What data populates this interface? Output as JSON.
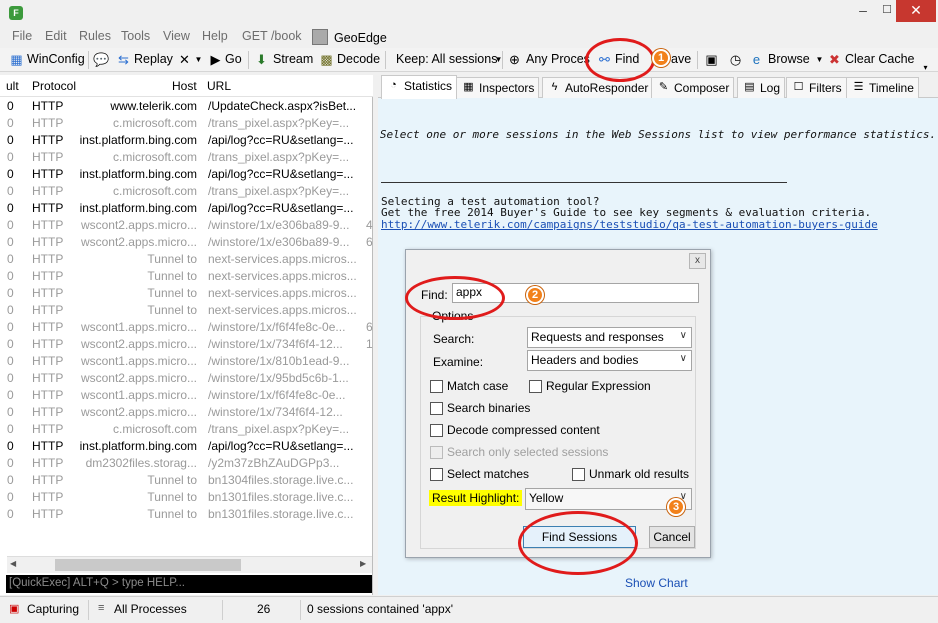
{
  "window": {
    "minimize": "–",
    "maximize": "☐",
    "close": "✕"
  },
  "menu": [
    "File",
    "Edit",
    "Rules",
    "Tools",
    "View",
    "Help",
    "GET /book"
  ],
  "geoedge": "GeoEdge",
  "toolbar": {
    "winconfig": "WinConfig",
    "replay": "Replay",
    "go": "Go",
    "stream": "Stream",
    "decode": "Decode",
    "keep": "Keep: All sessions",
    "any_process": "Any Proces",
    "find": "Find",
    "save": "ave",
    "browse": "Browse",
    "clear_cache": "Clear Cache"
  },
  "sessions": {
    "columns": [
      "ult",
      "Protocol",
      "Host",
      "URL"
    ],
    "rows": [
      {
        "r": "0",
        "protocol": "HTTP",
        "host": "www.telerik.com",
        "url": "/UpdateCheck.aspx?isBet...",
        "extra": "",
        "dim": false
      },
      {
        "r": "0",
        "protocol": "HTTP",
        "host": "c.microsoft.com",
        "url": "/trans_pixel.aspx?pKey=...",
        "extra": "",
        "dim": true
      },
      {
        "r": "0",
        "protocol": "HTTP",
        "host": "inst.platform.bing.com",
        "url": "/api/log?cc=RU&setlang=...",
        "extra": "",
        "dim": false
      },
      {
        "r": "0",
        "protocol": "HTTP",
        "host": "c.microsoft.com",
        "url": "/trans_pixel.aspx?pKey=...",
        "extra": "",
        "dim": true
      },
      {
        "r": "0",
        "protocol": "HTTP",
        "host": "inst.platform.bing.com",
        "url": "/api/log?cc=RU&setlang=...",
        "extra": "",
        "dim": false
      },
      {
        "r": "0",
        "protocol": "HTTP",
        "host": "c.microsoft.com",
        "url": "/trans_pixel.aspx?pKey=...",
        "extra": "",
        "dim": true
      },
      {
        "r": "0",
        "protocol": "HTTP",
        "host": "inst.platform.bing.com",
        "url": "/api/log?cc=RU&setlang=...",
        "extra": "",
        "dim": false
      },
      {
        "r": "0",
        "protocol": "HTTP",
        "host": "wscont2.apps.micro...",
        "url": "/winstore/1x/e306ba89-9...",
        "extra": "4",
        "dim": true
      },
      {
        "r": "0",
        "protocol": "HTTP",
        "host": "wscont2.apps.micro...",
        "url": "/winstore/1x/e306ba89-9...",
        "extra": "6",
        "dim": true
      },
      {
        "r": "0",
        "protocol": "HTTP",
        "host": "Tunnel to",
        "url": "next-services.apps.micros...",
        "extra": "",
        "dim": true
      },
      {
        "r": "0",
        "protocol": "HTTP",
        "host": "Tunnel to",
        "url": "next-services.apps.micros...",
        "extra": "",
        "dim": true
      },
      {
        "r": "0",
        "protocol": "HTTP",
        "host": "Tunnel to",
        "url": "next-services.apps.micros...",
        "extra": "",
        "dim": true
      },
      {
        "r": "0",
        "protocol": "HTTP",
        "host": "Tunnel to",
        "url": "next-services.apps.micros...",
        "extra": "",
        "dim": true
      },
      {
        "r": "0",
        "protocol": "HTTP",
        "host": "wscont1.apps.micro...",
        "url": "/winstore/1x/f6f4fe8c-0e...",
        "extra": "6",
        "dim": true
      },
      {
        "r": "0",
        "protocol": "HTTP",
        "host": "wscont2.apps.micro...",
        "url": "/winstore/1x/734f6f4-12...",
        "extra": "1",
        "dim": true
      },
      {
        "r": "0",
        "protocol": "HTTP",
        "host": "wscont1.apps.micro...",
        "url": "/winstore/1x/810b1ead-9...",
        "extra": "",
        "dim": true
      },
      {
        "r": "0",
        "protocol": "HTTP",
        "host": "wscont2.apps.micro...",
        "url": "/winstore/1x/95bd5c6b-1...",
        "extra": "",
        "dim": true
      },
      {
        "r": "0",
        "protocol": "HTTP",
        "host": "wscont1.apps.micro...",
        "url": "/winstore/1x/f6f4fe8c-0e...",
        "extra": "",
        "dim": true
      },
      {
        "r": "0",
        "protocol": "HTTP",
        "host": "wscont2.apps.micro...",
        "url": "/winstore/1x/734f6f4-12...",
        "extra": "",
        "dim": true
      },
      {
        "r": "0",
        "protocol": "HTTP",
        "host": "c.microsoft.com",
        "url": "/trans_pixel.aspx?pKey=...",
        "extra": "",
        "dim": true
      },
      {
        "r": "0",
        "protocol": "HTTP",
        "host": "inst.platform.bing.com",
        "url": "/api/log?cc=RU&setlang=...",
        "extra": "",
        "dim": false
      },
      {
        "r": "0",
        "protocol": "HTTP",
        "host": "dm2302files.storag...",
        "url": "/y2m37zBhZAuDGPp3...",
        "extra": "",
        "dim": true
      },
      {
        "r": "0",
        "protocol": "HTTP",
        "host": "Tunnel to",
        "url": "bn1304files.storage.live.c...",
        "extra": "",
        "dim": true
      },
      {
        "r": "0",
        "protocol": "HTTP",
        "host": "Tunnel to",
        "url": "bn1301files.storage.live.c...",
        "extra": "",
        "dim": true
      },
      {
        "r": "0",
        "protocol": "HTTP",
        "host": "Tunnel to",
        "url": "bn1301files.storage.live.c...",
        "extra": "",
        "dim": true
      }
    ]
  },
  "quickexec": "[QuickExec] ALT+Q > type HELP...",
  "tabs": [
    "Statistics",
    "Inspectors",
    "AutoResponder",
    "Composer",
    "Log",
    "Filters",
    "Timeline"
  ],
  "stats_message": "Select one or more sessions in the Web Sessions list to view performance statistics.",
  "promo": {
    "line1": "Selecting a test automation tool?",
    "line2": "Get the free 2014 Buyer's Guide to see key segments & evaluation criteria.",
    "link": "http://www.telerik.com/campaigns/teststudio/qa-test-automation-buyers-guide"
  },
  "show_chart": "Show Chart",
  "find_dialog": {
    "close": "x",
    "find_label": "Find:",
    "find_value": "appx",
    "options_label": "Options",
    "search_label": "Search:",
    "search_value": "Requests and responses",
    "examine_label": "Examine:",
    "examine_value": "Headers and bodies",
    "match_case": "Match case",
    "regex": "Regular Expression",
    "search_binaries": "Search binaries",
    "decode_compressed": "Decode compressed content",
    "selected_only": "Search only selected sessions",
    "select_matches": "Select matches",
    "unmark_old": "Unmark old results",
    "result_highlight_label": "Result Highlight:",
    "result_highlight_value": "Yellow",
    "find_sessions": "Find Sessions",
    "cancel": "Cancel"
  },
  "annotations": {
    "b1": "1",
    "b2": "2",
    "b3": "3",
    "ring_color": "#e01b1b",
    "badge_color": "#f2811b"
  },
  "status": {
    "capturing": "Capturing",
    "processes": "All Processes",
    "count": "26",
    "message": "0 sessions contained 'appx'"
  }
}
